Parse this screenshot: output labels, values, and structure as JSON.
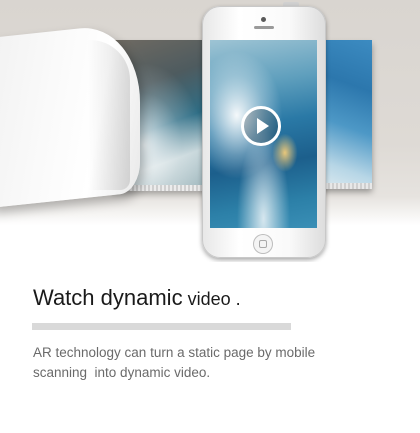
{
  "headline": {
    "part1": "Watch dynamic",
    "part2": " video",
    "part3": " ."
  },
  "description": {
    "line1": "AR technology can turn a static page by mobile",
    "line2": "scanning  into dynamic video."
  },
  "icons": {
    "play": "play-icon",
    "home": "home-button-icon"
  },
  "colors": {
    "headline": "#1a1a1a",
    "description": "#6a6a6a",
    "divider": "#d9d9d9"
  }
}
